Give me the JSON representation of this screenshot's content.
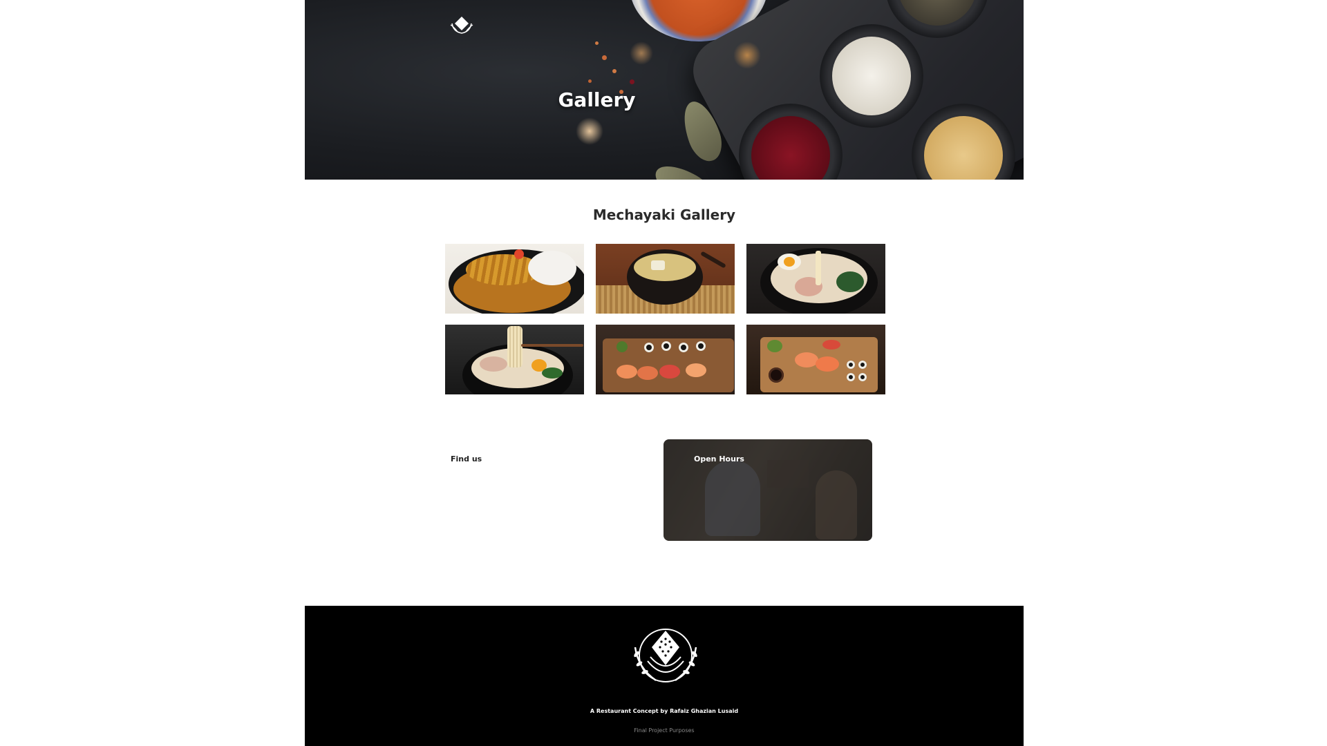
{
  "hero": {
    "title": "Gallery",
    "logo_icon": "onigiri-laurel-logo-icon"
  },
  "gallery": {
    "heading": "Mechayaki Gallery",
    "photos": [
      {
        "name": "katsu-curry-photo",
        "subject": "katsu curry with rice"
      },
      {
        "name": "miso-soup-photo",
        "subject": "miso soup bowl"
      },
      {
        "name": "ramen-egg-photo",
        "subject": "ramen with egg"
      },
      {
        "name": "ramen-noodle-lift-photo",
        "subject": "ramen with noodles lifted"
      },
      {
        "name": "sushi-platter-photo",
        "subject": "sushi platter"
      },
      {
        "name": "sushi-board-photo",
        "subject": "sushi board"
      }
    ]
  },
  "find_us": {
    "title": "Find us"
  },
  "open_hours": {
    "title": "Open Hours"
  },
  "footer": {
    "logo_icon": "onigiri-laurel-logo-icon",
    "credit": "A Restaurant Concept by Rafaiz Ghazian Lusaid",
    "sub": "Final Project Purposes"
  },
  "colors": {
    "footer_bg": "#000000",
    "hero_bg": "#1b1d21",
    "heading_text": "#2b2b2b"
  }
}
